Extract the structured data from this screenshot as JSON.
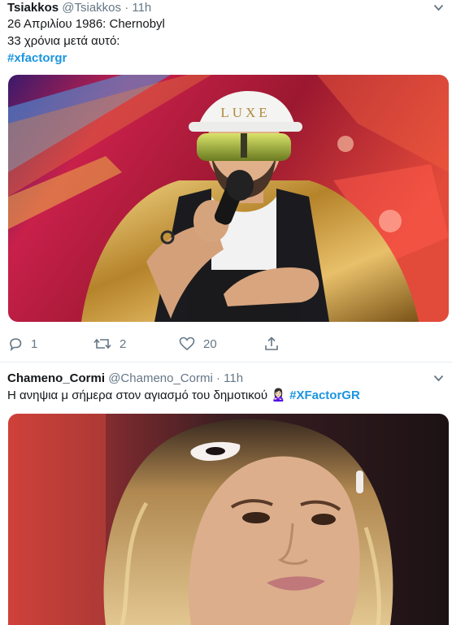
{
  "tweets": [
    {
      "name": "Tsiakkos",
      "handle": "@Tsiakkos",
      "dot": "·",
      "time": "11h",
      "lines": [
        "26 Απριλίου 1986: Chernobyl",
        "33 χρόνια μετά αυτό:"
      ],
      "hashtag": "#xfactorgr",
      "media_icon": "photo-performer-luxe-cap",
      "actions": {
        "reply_count": "1",
        "retweet_count": "2",
        "like_count": "20"
      }
    },
    {
      "name": "Chameno_Cormi",
      "handle": "@Chameno_Cormi",
      "dot": "·",
      "time": "11h",
      "text": "Η ανηψια μ σήμερα στον αγιασμό του δημοτικού",
      "emoji": "🙎🏻‍♀️",
      "hashtag": "#XFactorGR",
      "media_icon": "photo-woman-hair-clip"
    }
  ],
  "icons": {
    "chevron": "chevron-down-icon",
    "reply": "reply-icon",
    "retweet": "retweet-icon",
    "like": "heart-icon",
    "share": "share-icon"
  },
  "colors": {
    "link": "#1b95e0",
    "muted": "#657786",
    "text": "#14171a",
    "divider": "#e6ecf0"
  }
}
